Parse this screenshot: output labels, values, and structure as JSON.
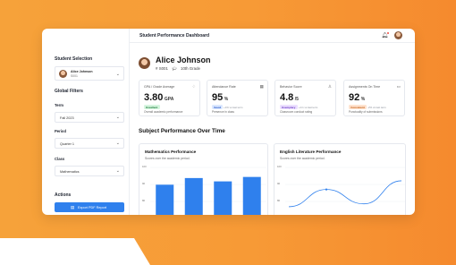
{
  "topbar": {
    "title": "Student Performance Dashboard"
  },
  "sidebar": {
    "student_selection_title": "Student Selection",
    "student": {
      "name": "Alice Johnson",
      "id": "S001"
    },
    "global_filters_title": "Global Filters",
    "term": {
      "label": "Term",
      "value": "Fall 2023"
    },
    "period": {
      "label": "Period",
      "value": "Quarter 1"
    },
    "class": {
      "label": "Class",
      "value": "Mathematics"
    },
    "actions_title": "Actions",
    "export_label": "Export PDF Report"
  },
  "student_header": {
    "name": "Alice Johnson",
    "id": "S001",
    "grade": "10th Grade"
  },
  "cards": [
    {
      "title": "GPA / Grade Average",
      "value": "3.80",
      "unit": "GPA",
      "badge": "Excellent",
      "delta": "",
      "sub": "Overall academic performance",
      "badge_color": "#1b7a3a"
    },
    {
      "title": "Attendance Rate",
      "value": "95",
      "unit": "%",
      "badge": "Good",
      "delta": "+1% vs last term",
      "sub": "Presence in class",
      "badge_color": "#1d4fc4"
    },
    {
      "title": "Behavior Score",
      "value": "4.8",
      "unit": "/5",
      "badge": "Exemplary",
      "delta": "+0.1 vs last term",
      "sub": "Classroom conduct rating",
      "badge_color": "#6b3cc4"
    },
    {
      "title": "Assignments On Time",
      "value": "92",
      "unit": "%",
      "badge": "Consistent",
      "delta": "-2% vs last term",
      "sub": "Punctuality of submissions",
      "badge_color": "#c0580c"
    }
  ],
  "section_title": "Subject Performance Over Time",
  "charts": [
    {
      "title": "Mathematics Performance",
      "subtitle": "Scores over the academic period."
    },
    {
      "title": "English Literature Performance",
      "subtitle": "Scores over the academic period."
    }
  ],
  "chart_data": [
    {
      "type": "bar",
      "title": "Mathematics Performance",
      "categories": [
        "",
        "",
        "",
        ""
      ],
      "values": [
        82,
        88,
        85,
        89
      ],
      "ylim": [
        50,
        100
      ],
      "yticks": [
        "100",
        "90",
        "80"
      ],
      "color": "#2f80ed"
    },
    {
      "type": "line",
      "title": "English Literature Performance",
      "x": [
        0,
        1,
        2,
        3
      ],
      "values": [
        78,
        90,
        80,
        96
      ],
      "ylim": [
        50,
        100
      ],
      "yticks": [
        "100",
        "90",
        "80"
      ],
      "color": "#2f80ed"
    }
  ],
  "icons": {
    "bell": "bell-icon",
    "chevron": "chevron-down-icon",
    "export": "document-icon"
  }
}
